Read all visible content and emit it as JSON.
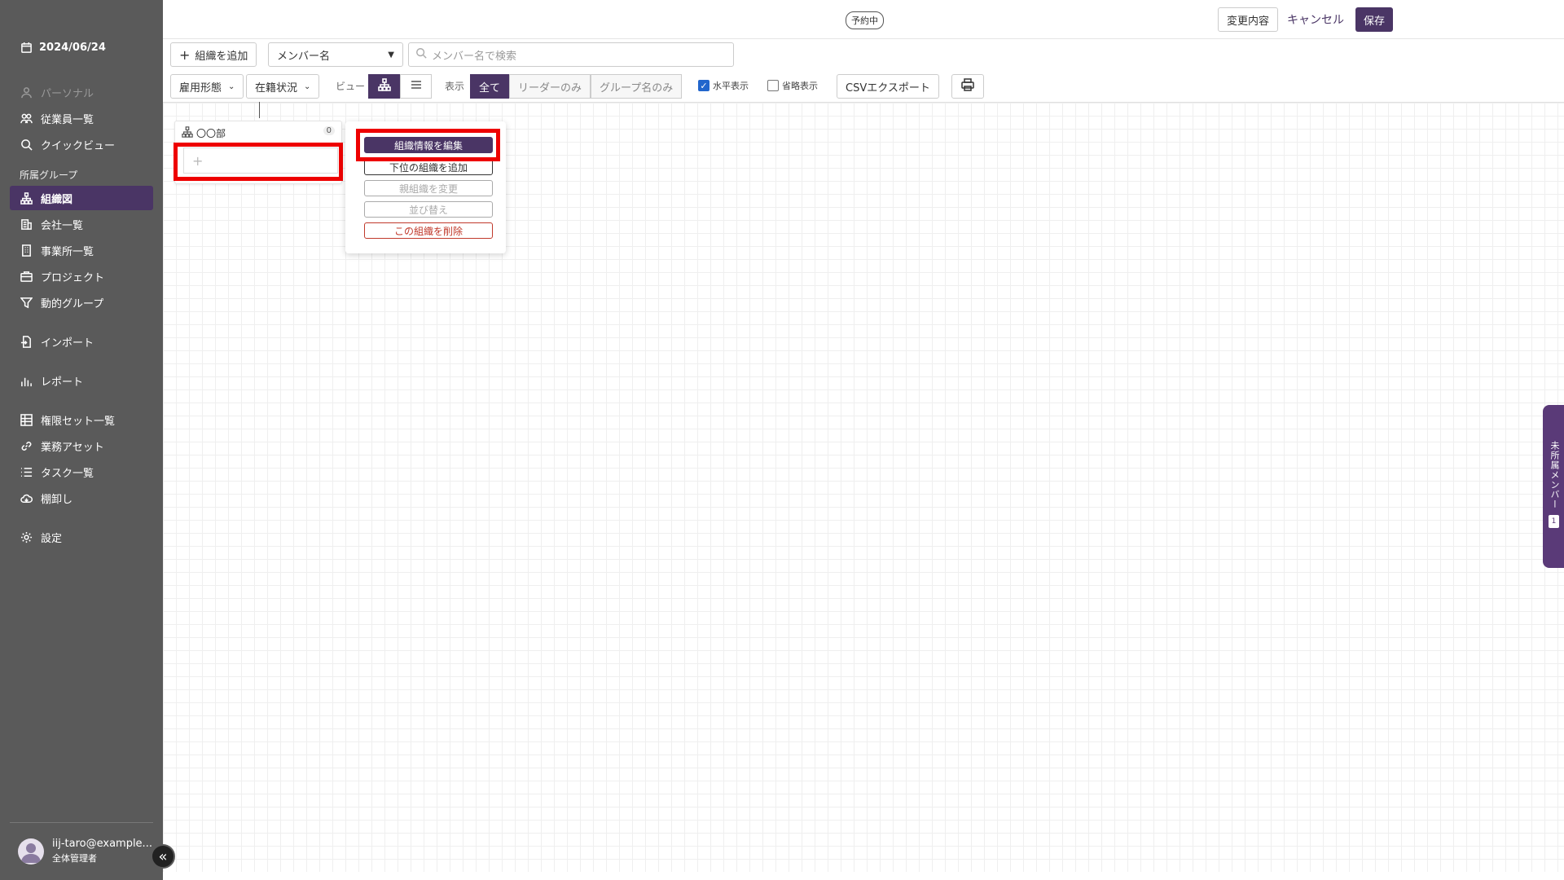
{
  "sidebar": {
    "date": "2024/06/24",
    "section_label": "所属グループ",
    "items": [
      {
        "label": "パーソナル",
        "icon": "person-icon"
      },
      {
        "label": "従業員一覧",
        "icon": "people-icon"
      },
      {
        "label": "クイックビュー",
        "icon": "search-icon"
      },
      {
        "label": "組織図",
        "icon": "org-chart-icon"
      },
      {
        "label": "会社一覧",
        "icon": "building-icon"
      },
      {
        "label": "事業所一覧",
        "icon": "office-icon"
      },
      {
        "label": "プロジェクト",
        "icon": "briefcase-icon"
      },
      {
        "label": "動的グループ",
        "icon": "filter-icon"
      },
      {
        "label": "インポート",
        "icon": "import-icon"
      },
      {
        "label": "レポート",
        "icon": "bar-chart-icon"
      },
      {
        "label": "権限セット一覧",
        "icon": "grid-icon"
      },
      {
        "label": "業務アセット",
        "icon": "link-icon"
      },
      {
        "label": "タスク一覧",
        "icon": "list-icon"
      },
      {
        "label": "棚卸し",
        "icon": "cloud-icon"
      },
      {
        "label": "設定",
        "icon": "gear-icon"
      }
    ],
    "user": {
      "email": "iij-taro@example...",
      "role": "全体管理者"
    }
  },
  "topbar": {
    "status_badge": "予約中",
    "changes_label": "変更内容",
    "cancel_label": "キャンセル",
    "save_label": "保存"
  },
  "toolbar": {
    "add_org_label": "組織を追加",
    "member_select_value": "メンバー名",
    "search_placeholder": "メンバー名で検索",
    "employment_type_label": "雇用形態",
    "enrollment_status_label": "在籍状況",
    "view_label": "ビュー",
    "display_label": "表示",
    "display_options": [
      "全て",
      "リーダーのみ",
      "グループ名のみ"
    ],
    "horizontal_label": "水平表示",
    "horizontal_checked": true,
    "abbrev_label": "省略表示",
    "abbrev_checked": false,
    "csv_label": "CSVエクスポート"
  },
  "org_card": {
    "name": "〇〇部",
    "count": "0",
    "add_placeholder": "+"
  },
  "context_menu": {
    "items": [
      "組織情報を編集",
      "下位の組織を追加",
      "親組織を変更",
      "並び替え",
      "この組織を削除"
    ]
  },
  "side_tab": {
    "label": "未所属メンバー",
    "count": "1"
  },
  "colors": {
    "accent": "#4a3565",
    "sidebar_bg": "#5a5a5a",
    "highlight": "#ee0000",
    "danger": "#c0392b"
  }
}
